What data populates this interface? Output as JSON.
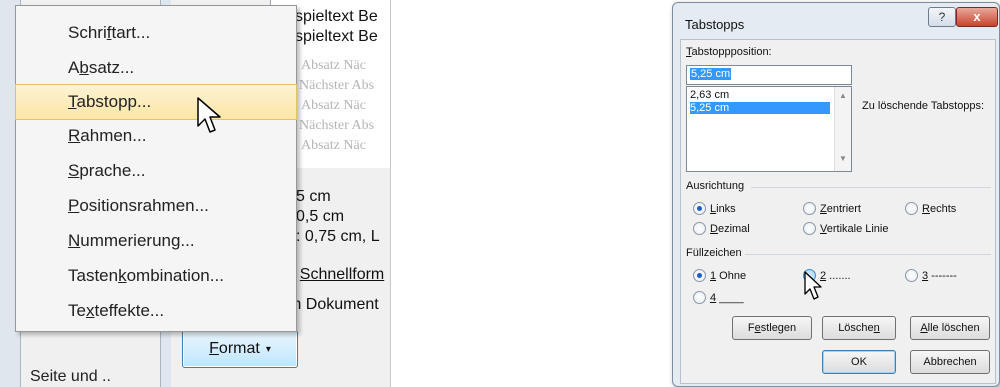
{
  "left": {
    "bottom_text": "Seite und ..",
    "preview": {
      "lines": [
        "spieltext Be",
        "spieltext Be"
      ],
      "ghost_lines": [
        "Absatz Näc",
        "Nächster Abs",
        "Absatz Näc",
        "Nächster Abs",
        "Absatz Näc"
      ]
    },
    "description": {
      "line1": "5 cm",
      "line2": "0,5 cm",
      "line3": ":  0,75 cm, L",
      "line4_prefix": "r ",
      "line4_link": "Schnellform",
      "line5": "m Dokument"
    },
    "format_button": {
      "label": "Format",
      "caret": "▾",
      "underline": "F",
      "rest": "ormat"
    },
    "menu": {
      "items": [
        {
          "pre": "Schri",
          "u": "f",
          "post": "tart..."
        },
        {
          "pre": "A",
          "u": "b",
          "post": "satz..."
        },
        {
          "pre": "",
          "u": "T",
          "post": "abstopp..."
        },
        {
          "pre": "",
          "u": "R",
          "post": "ahmen..."
        },
        {
          "pre": "",
          "u": "S",
          "post": "prache..."
        },
        {
          "pre": "",
          "u": "P",
          "post": "ositionsrahmen..."
        },
        {
          "pre": "",
          "u": "N",
          "post": "ummerierung..."
        },
        {
          "pre": "Tasten",
          "u": "k",
          "post": "ombination..."
        },
        {
          "pre": "Te",
          "u": "x",
          "post": "teffekte..."
        }
      ]
    }
  },
  "dialog": {
    "title": "Tabstopps",
    "help_button": "?",
    "close_button": "x",
    "position_label_u": "T",
    "position_label_rest": "abstoppposition:",
    "position_value": "5,25 cm",
    "list": [
      "2,63 cm",
      "5,25 cm"
    ],
    "to_delete_label": "Zu löschende Tabstopps:",
    "alignment": {
      "title": "Ausrichtung",
      "options": [
        {
          "u": "L",
          "rest": "inks",
          "checked": true
        },
        {
          "u": "Z",
          "rest": "entriert",
          "checked": false
        },
        {
          "u": "R",
          "rest": "echts",
          "checked": false
        },
        {
          "u": "D",
          "rest": "ezimal",
          "checked": false
        },
        {
          "u": "V",
          "rest": "ertikale Linie",
          "checked": false
        }
      ]
    },
    "fill": {
      "title": "Füllzeichen",
      "options": [
        {
          "u": "1",
          "rest": " Ohne",
          "checked": true
        },
        {
          "u": "2",
          "rest": " .......",
          "checked": false
        },
        {
          "u": "3",
          "rest": " -------",
          "checked": false
        },
        {
          "u": "4",
          "rest": " ____",
          "checked": false
        }
      ]
    },
    "buttons": {
      "set_pre": "F",
      "set_u": "e",
      "set_post": "stlegen",
      "delete_pre": "Lösche",
      "delete_u": "n",
      "delete_post": "",
      "delete_all_pre": "",
      "delete_all_u": "A",
      "delete_all_post": "lle löschen",
      "ok": "OK",
      "cancel": "Abbrechen"
    }
  },
  "colors": {
    "accent": "#3399ff",
    "menu_highlight": "#fbe6a6",
    "close": "#c7442e"
  }
}
